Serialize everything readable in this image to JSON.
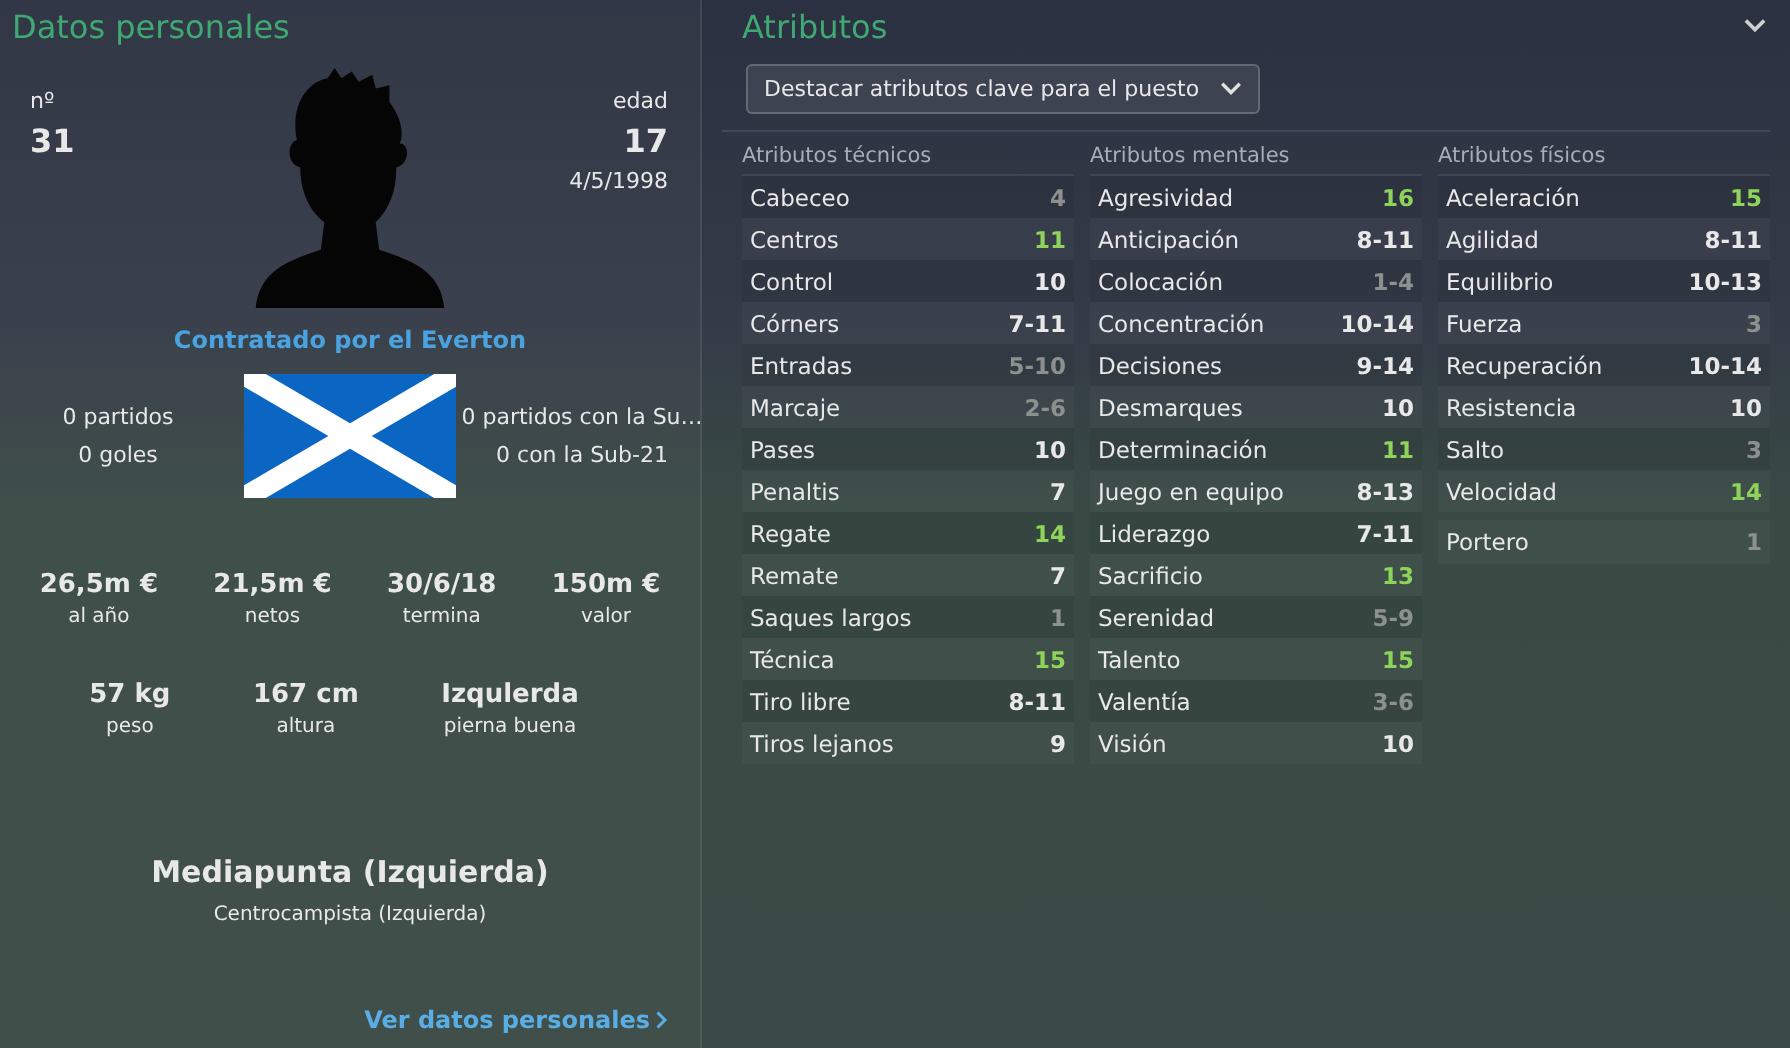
{
  "personal": {
    "title": "Datos personales",
    "number_label": "nº",
    "number": "31",
    "age_label": "edad",
    "age": "17",
    "birth_date": "4/5/1998",
    "contract": "Contratado por el Everton",
    "caps": [
      "0 partidos",
      "0 goles"
    ],
    "youth_caps": [
      "0 partidos con la Su…",
      "0 con la Sub-21"
    ],
    "money": [
      {
        "value": "26,5m €",
        "label": "al año"
      },
      {
        "value": "21,5m €",
        "label": "netos"
      },
      {
        "value": "30/6/18",
        "label": "termina"
      },
      {
        "value": "150m €",
        "label": "valor"
      }
    ],
    "body": [
      {
        "value": "57 kg",
        "label": "peso"
      },
      {
        "value": "167 cm",
        "label": "altura"
      },
      {
        "value": "Izqulerda",
        "label": "pierna buena"
      }
    ],
    "position": "Mediapunta (Izquierda)",
    "secondary_position": "Centrocampista (Izquierda)",
    "link": "Ver datos personales"
  },
  "attributes": {
    "title": "Atributos",
    "highlight_dropdown": "Destacar atributos clave para el puesto",
    "columns": [
      {
        "heading": "Atributos técnicos",
        "rows": [
          {
            "name": "Cabeceo",
            "value": "4",
            "color": "#8c918e"
          },
          {
            "name": "Centros",
            "value": "11",
            "color": "#8ed35a"
          },
          {
            "name": "Control",
            "value": "10",
            "color": "#e8e8e8"
          },
          {
            "name": "Córners",
            "value": "7-11",
            "color": "#e8e8e8"
          },
          {
            "name": "Entradas",
            "value": "5-10",
            "color": "#8c918e"
          },
          {
            "name": "Marcaje",
            "value": "2-6",
            "color": "#8c918e"
          },
          {
            "name": "Pases",
            "value": "10",
            "color": "#e8e8e8"
          },
          {
            "name": "Penaltis",
            "value": "7",
            "color": "#e8e8e8"
          },
          {
            "name": "Regate",
            "value": "14",
            "color": "#8ed35a"
          },
          {
            "name": "Remate",
            "value": "7",
            "color": "#e8e8e8"
          },
          {
            "name": "Saques largos",
            "value": "1",
            "color": "#8c918e"
          },
          {
            "name": "Técnica",
            "value": "15",
            "color": "#8ed35a"
          },
          {
            "name": "Tiro libre",
            "value": "8-11",
            "color": "#e8e8e8"
          },
          {
            "name": "Tiros lejanos",
            "value": "9",
            "color": "#e8e8e8"
          }
        ]
      },
      {
        "heading": "Atributos mentales",
        "rows": [
          {
            "name": "Agresividad",
            "value": "16",
            "color": "#8ed35a"
          },
          {
            "name": "Anticipación",
            "value": "8-11",
            "color": "#e8e8e8"
          },
          {
            "name": "Colocación",
            "value": "1-4",
            "color": "#8c918e"
          },
          {
            "name": "Concentración",
            "value": "10-14",
            "color": "#e8e8e8"
          },
          {
            "name": "Decisiones",
            "value": "9-14",
            "color": "#e8e8e8"
          },
          {
            "name": "Desmarques",
            "value": "10",
            "color": "#e8e8e8"
          },
          {
            "name": "Determinación",
            "value": "11",
            "color": "#8ed35a"
          },
          {
            "name": "Juego en equipo",
            "value": "8-13",
            "color": "#e8e8e8"
          },
          {
            "name": "Liderazgo",
            "value": "7-11",
            "color": "#e8e8e8"
          },
          {
            "name": "Sacrificio",
            "value": "13",
            "color": "#8ed35a"
          },
          {
            "name": "Serenidad",
            "value": "5-9",
            "color": "#8c918e"
          },
          {
            "name": "Talento",
            "value": "15",
            "color": "#8ed35a"
          },
          {
            "name": "Valentía",
            "value": "3-6",
            "color": "#8c918e"
          },
          {
            "name": "Visión",
            "value": "10",
            "color": "#e8e8e8"
          }
        ]
      },
      {
        "heading": "Atributos físicos",
        "rows": [
          {
            "name": "Aceleración",
            "value": "15",
            "color": "#8ed35a"
          },
          {
            "name": "Agilidad",
            "value": "8-11",
            "color": "#e8e8e8"
          },
          {
            "name": "Equilibrio",
            "value": "10-13",
            "color": "#e8e8e8"
          },
          {
            "name": "Fuerza",
            "value": "3",
            "color": "#8c918e"
          },
          {
            "name": "Recuperación",
            "value": "10-14",
            "color": "#e8e8e8"
          },
          {
            "name": "Resistencia",
            "value": "10",
            "color": "#e8e8e8"
          },
          {
            "name": "Salto",
            "value": "3",
            "color": "#8c918e"
          },
          {
            "name": "Velocidad",
            "value": "14",
            "color": "#8ed35a"
          }
        ],
        "extra": {
          "name": "Portero",
          "value": "1",
          "color": "#8c918e"
        }
      }
    ]
  }
}
